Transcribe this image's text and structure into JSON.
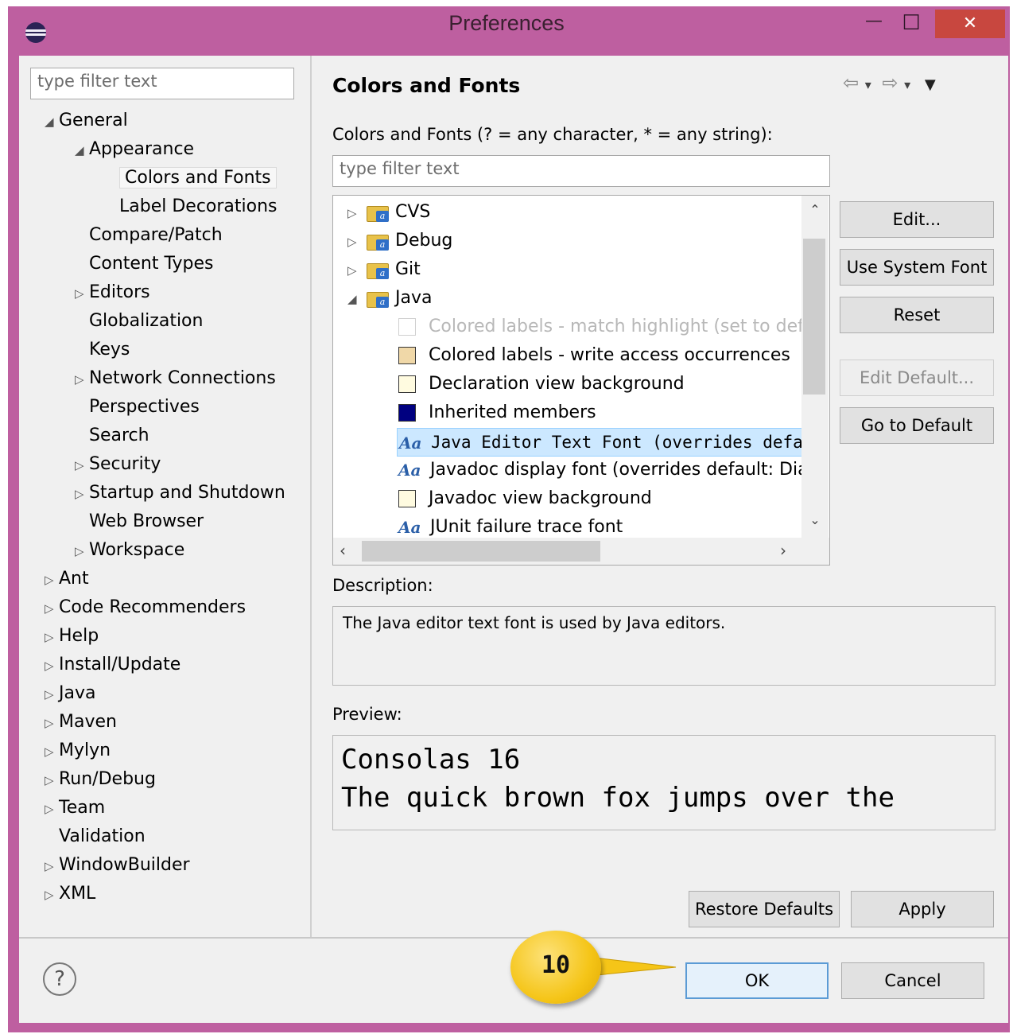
{
  "window": {
    "title": "Preferences",
    "minimize_glyph": "—",
    "maximize_glyph": "☐",
    "close_glyph": "✕",
    "colors": {
      "frame": "#be5fa0",
      "close": "#c8473f"
    }
  },
  "left_panel": {
    "filter_placeholder": "type filter text",
    "tree": [
      {
        "label": "General",
        "indent": 0,
        "arrow": "◢"
      },
      {
        "label": "Appearance",
        "indent": 1,
        "arrow": "◢"
      },
      {
        "label": "Colors and Fonts",
        "indent": 2,
        "arrow": "",
        "selected": true
      },
      {
        "label": "Label Decorations",
        "indent": 2,
        "arrow": ""
      },
      {
        "label": "Compare/Patch",
        "indent": 1,
        "arrow": ""
      },
      {
        "label": "Content Types",
        "indent": 1,
        "arrow": ""
      },
      {
        "label": "Editors",
        "indent": 1,
        "arrow": "▷"
      },
      {
        "label": "Globalization",
        "indent": 1,
        "arrow": ""
      },
      {
        "label": "Keys",
        "indent": 1,
        "arrow": ""
      },
      {
        "label": "Network Connections",
        "indent": 1,
        "arrow": "▷"
      },
      {
        "label": "Perspectives",
        "indent": 1,
        "arrow": ""
      },
      {
        "label": "Search",
        "indent": 1,
        "arrow": ""
      },
      {
        "label": "Security",
        "indent": 1,
        "arrow": "▷"
      },
      {
        "label": "Startup and Shutdown",
        "indent": 1,
        "arrow": "▷"
      },
      {
        "label": "Web Browser",
        "indent": 1,
        "arrow": ""
      },
      {
        "label": "Workspace",
        "indent": 1,
        "arrow": "▷"
      },
      {
        "label": "Ant",
        "indent": 0,
        "arrow": "▷"
      },
      {
        "label": "Code Recommenders",
        "indent": 0,
        "arrow": "▷"
      },
      {
        "label": "Help",
        "indent": 0,
        "arrow": "▷"
      },
      {
        "label": "Install/Update",
        "indent": 0,
        "arrow": "▷"
      },
      {
        "label": "Java",
        "indent": 0,
        "arrow": "▷"
      },
      {
        "label": "Maven",
        "indent": 0,
        "arrow": "▷"
      },
      {
        "label": "Mylyn",
        "indent": 0,
        "arrow": "▷"
      },
      {
        "label": "Run/Debug",
        "indent": 0,
        "arrow": "▷"
      },
      {
        "label": "Team",
        "indent": 0,
        "arrow": "▷"
      },
      {
        "label": "Validation",
        "indent": 0,
        "arrow": ""
      },
      {
        "label": "WindowBuilder",
        "indent": 0,
        "arrow": "▷"
      },
      {
        "label": "XML",
        "indent": 0,
        "arrow": "▷"
      }
    ]
  },
  "page": {
    "title": "Colors and Fonts",
    "nav": {
      "back": "⇦",
      "back_menu": "▾",
      "forward": "⇨",
      "forward_menu": "▾",
      "view_menu": "▼"
    },
    "filter_label": "Colors and Fonts (? = any character, * = any string):",
    "filter_placeholder": "type filter text",
    "tree": [
      {
        "kind": "category",
        "label": "CVS",
        "arrow": "▷"
      },
      {
        "kind": "category",
        "label": "Debug",
        "arrow": "▷"
      },
      {
        "kind": "category",
        "label": "Git",
        "arrow": "▷"
      },
      {
        "kind": "category",
        "label": "Java",
        "arrow": "◢"
      },
      {
        "kind": "color",
        "label": "Colored labels - match highlight (set to default: ...)",
        "color": "#ffffff",
        "disabled": true
      },
      {
        "kind": "color",
        "label": "Colored labels - write access occurrences",
        "color": "#f0d8a8"
      },
      {
        "kind": "color",
        "label": "Declaration view background",
        "color": "#fffbe0"
      },
      {
        "kind": "color",
        "label": "Inherited members",
        "color": "#000080"
      },
      {
        "kind": "font",
        "label": "Java Editor Text Font (overrides default: Text Font)",
        "selected": true,
        "mono": true
      },
      {
        "kind": "font",
        "label": "Javadoc display font (overrides default: Dialog Font)"
      },
      {
        "kind": "color",
        "label": "Javadoc view background",
        "color": "#fffbe0"
      },
      {
        "kind": "font",
        "label": "JUnit failure trace font"
      }
    ],
    "font_icon_text": "Aa",
    "buttons": {
      "edit": "Edit...",
      "use_system_font": "Use System Font",
      "reset": "Reset",
      "edit_default": "Edit Default...",
      "go_to_default": "Go to Default"
    },
    "description_label": "Description:",
    "description_text": "The Java editor text font is used by Java editors.",
    "preview_label": "Preview:",
    "preview_lines": [
      "Consolas 16",
      "The quick brown fox jumps over the"
    ],
    "restore_defaults": "Restore Defaults",
    "apply": "Apply"
  },
  "footer": {
    "help_glyph": "?",
    "ok": "OK",
    "cancel": "Cancel",
    "callout_number": "10",
    "callout_color": "#f5c518"
  }
}
